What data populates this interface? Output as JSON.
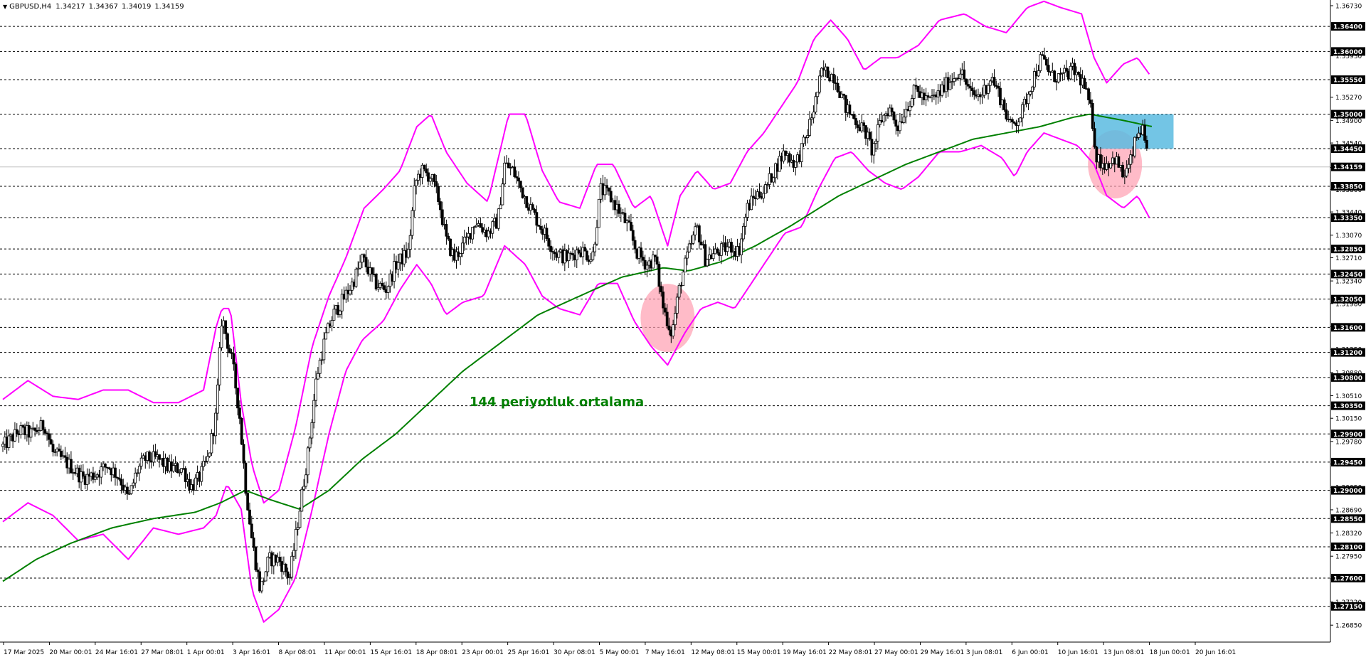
{
  "header": {
    "symbol": "GBPUSD,H4",
    "ohlc": [
      "1.34217",
      "1.34367",
      "1.34019",
      "1.34159"
    ]
  },
  "colors": {
    "background": "#ffffff",
    "candle": "#000000",
    "bollinger": "#ff00ff",
    "ma": "#008000",
    "level_line": "#000000",
    "highlight_circle": "#ff9eb0",
    "zone_box": "#5bbbe0",
    "current_price_line": "#c0c0c0"
  },
  "chart_data": {
    "type": "candlestick",
    "symbol": "GBPUSD",
    "timeframe": "H4",
    "annotation": "144 periyotluk ortalama",
    "y_axis": {
      "range": [
        1.2658,
        1.3673
      ],
      "tick_labels": [
        "1.36730",
        "1.35930",
        "1.35270",
        "1.34900",
        "1.34540",
        "1.34150",
        "1.33800",
        "1.33440",
        "1.33070",
        "1.32710",
        "1.32340",
        "1.31980",
        "1.31610",
        "1.31250",
        "1.30880",
        "1.30510",
        "1.30150",
        "1.29780",
        "1.29420",
        "1.29050",
        "1.28690",
        "1.28320",
        "1.27950",
        "1.27590",
        "1.27220",
        "1.26850"
      ],
      "highlighted_levels": [
        "1.36400",
        "1.36000",
        "1.35550",
        "1.35000",
        "1.34450",
        "1.34159",
        "1.33850",
        "1.33350",
        "1.32850",
        "1.32450",
        "1.32050",
        "1.31600",
        "1.31200",
        "1.30800",
        "1.30350",
        "1.29900",
        "1.29450",
        "1.29000",
        "1.28550",
        "1.28100",
        "1.27600",
        "1.27150"
      ],
      "current_price": "1.34159"
    },
    "x_axis": {
      "labels": [
        "17 Mar 2025",
        "20 Mar 00:01",
        "24 Mar 16:01",
        "27 Mar 08:01",
        "1 Apr 00:01",
        "3 Apr 16:01",
        "8 Apr 08:01",
        "11 Apr 00:01",
        "15 Apr 16:01",
        "18 Apr 08:01",
        "23 Apr 00:01",
        "25 Apr 16:01",
        "30 Apr 08:01",
        "5 May 00:01",
        "7 May 16:01",
        "12 May 08:01",
        "15 May 00:01",
        "19 May 16:01",
        "22 May 08:01",
        "27 May 00:01",
        "29 May 16:01",
        "3 Jun 08:01",
        "6 Jun 00:01",
        "10 Jun 16:01",
        "13 Jun 08:01",
        "18 Jun 00:01",
        "20 Jun 16:01"
      ]
    },
    "price_path": [
      [
        0,
        1.297
      ],
      [
        20,
        1.2995
      ],
      [
        35,
        1.299
      ],
      [
        50,
        1.3005
      ],
      [
        60,
        1.296
      ],
      [
        80,
        1.294
      ],
      [
        95,
        1.292
      ],
      [
        110,
        1.2925
      ],
      [
        125,
        1.294
      ],
      [
        140,
        1.292
      ],
      [
        150,
        1.2885
      ],
      [
        160,
        1.293
      ],
      [
        170,
        1.295
      ],
      [
        185,
        1.295
      ],
      [
        200,
        1.2935
      ],
      [
        215,
        1.2935
      ],
      [
        225,
        1.2905
      ],
      [
        235,
        1.292
      ],
      [
        245,
        1.295
      ],
      [
        255,
        1.302
      ],
      [
        262,
        1.318
      ],
      [
        268,
        1.314
      ],
      [
        275,
        1.31
      ],
      [
        283,
        1.302
      ],
      [
        290,
        1.291
      ],
      [
        298,
        1.282
      ],
      [
        308,
        1.274
      ],
      [
        318,
        1.279
      ],
      [
        330,
        1.279
      ],
      [
        343,
        1.276
      ],
      [
        355,
        1.287
      ],
      [
        365,
        1.296
      ],
      [
        375,
        1.308
      ],
      [
        385,
        1.314
      ],
      [
        395,
        1.318
      ],
      [
        405,
        1.32
      ],
      [
        418,
        1.323
      ],
      [
        430,
        1.327
      ],
      [
        445,
        1.323
      ],
      [
        458,
        1.322
      ],
      [
        470,
        1.326
      ],
      [
        485,
        1.328
      ],
      [
        493,
        1.339
      ],
      [
        500,
        1.341
      ],
      [
        512,
        1.34
      ],
      [
        522,
        1.336
      ],
      [
        530,
        1.33
      ],
      [
        540,
        1.327
      ],
      [
        555,
        1.33
      ],
      [
        565,
        1.333
      ],
      [
        580,
        1.331
      ],
      [
        592,
        1.333
      ],
      [
        600,
        1.342
      ],
      [
        610,
        1.341
      ],
      [
        620,
        1.338
      ],
      [
        635,
        1.334
      ],
      [
        648,
        1.331
      ],
      [
        660,
        1.328
      ],
      [
        675,
        1.327
      ],
      [
        690,
        1.3285
      ],
      [
        705,
        1.327
      ],
      [
        715,
        1.338
      ],
      [
        725,
        1.337
      ],
      [
        735,
        1.335
      ],
      [
        748,
        1.332
      ],
      [
        758,
        1.328
      ],
      [
        770,
        1.326
      ],
      [
        780,
        1.327
      ],
      [
        790,
        1.319
      ],
      [
        800,
        1.315
      ],
      [
        810,
        1.323
      ],
      [
        820,
        1.328
      ],
      [
        830,
        1.332
      ],
      [
        840,
        1.327
      ],
      [
        855,
        1.328
      ],
      [
        870,
        1.329
      ],
      [
        880,
        1.328
      ],
      [
        890,
        1.335
      ],
      [
        900,
        1.337
      ],
      [
        912,
        1.338
      ],
      [
        922,
        1.341
      ],
      [
        935,
        1.344
      ],
      [
        948,
        1.342
      ],
      [
        960,
        1.346
      ],
      [
        970,
        1.351
      ],
      [
        980,
        1.357
      ],
      [
        995,
        1.356
      ],
      [
        1008,
        1.351
      ],
      [
        1020,
        1.349
      ],
      [
        1032,
        1.347
      ],
      [
        1040,
        1.344
      ],
      [
        1050,
        1.349
      ],
      [
        1060,
        1.351
      ],
      [
        1070,
        1.348
      ],
      [
        1080,
        1.351
      ],
      [
        1092,
        1.354
      ],
      [
        1105,
        1.352
      ],
      [
        1118,
        1.353
      ],
      [
        1130,
        1.355
      ],
      [
        1145,
        1.357
      ],
      [
        1158,
        1.353
      ],
      [
        1170,
        1.353
      ],
      [
        1182,
        1.356
      ],
      [
        1195,
        1.352
      ],
      [
        1205,
        1.348
      ],
      [
        1218,
        1.35
      ],
      [
        1230,
        1.355
      ],
      [
        1242,
        1.359
      ],
      [
        1255,
        1.356
      ],
      [
        1268,
        1.356
      ],
      [
        1280,
        1.357
      ],
      [
        1292,
        1.355
      ],
      [
        1302,
        1.35
      ],
      [
        1308,
        1.343
      ],
      [
        1318,
        1.342
      ],
      [
        1330,
        1.343
      ],
      [
        1340,
        1.34
      ],
      [
        1348,
        1.342
      ],
      [
        1355,
        1.346
      ],
      [
        1362,
        1.348
      ],
      [
        1370,
        1.342
      ]
    ],
    "ma_path": [
      [
        0,
        1.2755
      ],
      [
        40,
        1.279
      ],
      [
        80,
        1.2815
      ],
      [
        130,
        1.284
      ],
      [
        180,
        1.2855
      ],
      [
        230,
        1.2865
      ],
      [
        260,
        1.288
      ],
      [
        290,
        1.29
      ],
      [
        320,
        1.2885
      ],
      [
        355,
        1.287
      ],
      [
        390,
        1.29
      ],
      [
        430,
        1.295
      ],
      [
        470,
        1.299
      ],
      [
        510,
        1.304
      ],
      [
        550,
        1.309
      ],
      [
        600,
        1.314
      ],
      [
        640,
        1.318
      ],
      [
        690,
        1.321
      ],
      [
        740,
        1.324
      ],
      [
        790,
        1.3255
      ],
      [
        820,
        1.325
      ],
      [
        860,
        1.3265
      ],
      [
        900,
        1.329
      ],
      [
        940,
        1.332
      ],
      [
        970,
        1.3345
      ],
      [
        1000,
        1.337
      ],
      [
        1040,
        1.3395
      ],
      [
        1080,
        1.342
      ],
      [
        1120,
        1.344
      ],
      [
        1160,
        1.346
      ],
      [
        1200,
        1.347
      ],
      [
        1240,
        1.348
      ],
      [
        1280,
        1.3495
      ],
      [
        1300,
        1.35
      ],
      [
        1340,
        1.349
      ],
      [
        1375,
        1.348
      ]
    ],
    "bb_upper": [
      [
        0,
        1.3045
      ],
      [
        30,
        1.3075
      ],
      [
        60,
        1.305
      ],
      [
        90,
        1.3045
      ],
      [
        120,
        1.306
      ],
      [
        150,
        1.306
      ],
      [
        180,
        1.304
      ],
      [
        210,
        1.304
      ],
      [
        240,
        1.306
      ],
      [
        255,
        1.316
      ],
      [
        262,
        1.319
      ],
      [
        272,
        1.319
      ],
      [
        285,
        1.304
      ],
      [
        298,
        1.294
      ],
      [
        312,
        1.288
      ],
      [
        330,
        1.29
      ],
      [
        350,
        1.3
      ],
      [
        370,
        1.313
      ],
      [
        390,
        1.321
      ],
      [
        410,
        1.327
      ],
      [
        432,
        1.335
      ],
      [
        455,
        1.338
      ],
      [
        475,
        1.341
      ],
      [
        495,
        1.348
      ],
      [
        512,
        1.35
      ],
      [
        530,
        1.344
      ],
      [
        555,
        1.339
      ],
      [
        580,
        1.336
      ],
      [
        605,
        1.35
      ],
      [
        625,
        1.35
      ],
      [
        645,
        1.341
      ],
      [
        665,
        1.336
      ],
      [
        690,
        1.335
      ],
      [
        710,
        1.342
      ],
      [
        730,
        1.342
      ],
      [
        755,
        1.335
      ],
      [
        775,
        1.337
      ],
      [
        795,
        1.329
      ],
      [
        810,
        1.337
      ],
      [
        830,
        1.341
      ],
      [
        850,
        1.338
      ],
      [
        870,
        1.339
      ],
      [
        890,
        1.344
      ],
      [
        910,
        1.347
      ],
      [
        930,
        1.351
      ],
      [
        950,
        1.355
      ],
      [
        970,
        1.362
      ],
      [
        990,
        1.365
      ],
      [
        1010,
        1.362
      ],
      [
        1030,
        1.357
      ],
      [
        1050,
        1.359
      ],
      [
        1070,
        1.359
      ],
      [
        1095,
        1.361
      ],
      [
        1120,
        1.365
      ],
      [
        1150,
        1.366
      ],
      [
        1175,
        1.364
      ],
      [
        1200,
        1.363
      ],
      [
        1225,
        1.367
      ],
      [
        1245,
        1.368
      ],
      [
        1265,
        1.367
      ],
      [
        1290,
        1.366
      ],
      [
        1305,
        1.359
      ],
      [
        1320,
        1.355
      ],
      [
        1340,
        1.358
      ],
      [
        1357,
        1.359
      ],
      [
        1373,
        1.356
      ]
    ],
    "bb_lower": [
      [
        0,
        1.285
      ],
      [
        30,
        1.288
      ],
      [
        60,
        1.286
      ],
      [
        90,
        1.282
      ],
      [
        120,
        1.283
      ],
      [
        150,
        1.279
      ],
      [
        180,
        1.284
      ],
      [
        210,
        1.283
      ],
      [
        240,
        1.284
      ],
      [
        255,
        1.286
      ],
      [
        268,
        1.291
      ],
      [
        285,
        1.287
      ],
      [
        298,
        1.274
      ],
      [
        312,
        1.269
      ],
      [
        330,
        1.271
      ],
      [
        350,
        1.276
      ],
      [
        370,
        1.287
      ],
      [
        390,
        1.299
      ],
      [
        410,
        1.309
      ],
      [
        430,
        1.314
      ],
      [
        455,
        1.317
      ],
      [
        475,
        1.322
      ],
      [
        495,
        1.326
      ],
      [
        512,
        1.323
      ],
      [
        530,
        1.318
      ],
      [
        550,
        1.32
      ],
      [
        575,
        1.321
      ],
      [
        600,
        1.329
      ],
      [
        625,
        1.326
      ],
      [
        645,
        1.321
      ],
      [
        665,
        1.319
      ],
      [
        690,
        1.318
      ],
      [
        712,
        1.323
      ],
      [
        735,
        1.323
      ],
      [
        755,
        1.317
      ],
      [
        775,
        1.313
      ],
      [
        795,
        1.31
      ],
      [
        815,
        1.315
      ],
      [
        835,
        1.319
      ],
      [
        855,
        1.32
      ],
      [
        875,
        1.319
      ],
      [
        895,
        1.323
      ],
      [
        915,
        1.327
      ],
      [
        935,
        1.331
      ],
      [
        955,
        1.332
      ],
      [
        975,
        1.338
      ],
      [
        995,
        1.343
      ],
      [
        1015,
        1.344
      ],
      [
        1035,
        1.341
      ],
      [
        1055,
        1.339
      ],
      [
        1075,
        1.338
      ],
      [
        1095,
        1.34
      ],
      [
        1120,
        1.344
      ],
      [
        1145,
        1.344
      ],
      [
        1170,
        1.345
      ],
      [
        1195,
        1.343
      ],
      [
        1210,
        1.34
      ],
      [
        1225,
        1.344
      ],
      [
        1245,
        1.347
      ],
      [
        1265,
        1.346
      ],
      [
        1285,
        1.345
      ],
      [
        1305,
        1.342
      ],
      [
        1320,
        1.337
      ],
      [
        1340,
        1.335
      ],
      [
        1357,
        1.337
      ],
      [
        1373,
        1.333
      ]
    ],
    "highlights": [
      {
        "type": "circle",
        "center_x_index": 795,
        "center_price": 1.3175,
        "note": "pink circle near 12 May low"
      },
      {
        "type": "circle",
        "center_x_index": 1330,
        "center_price": 1.342,
        "note": "pink circle near 18 Jun low"
      },
      {
        "type": "rect",
        "x_from_index": 1305,
        "x_to_index": 1400,
        "price_top": 1.35,
        "price_bottom": 1.3445,
        "note": "blue zone 1.3500-1.3445"
      }
    ]
  }
}
